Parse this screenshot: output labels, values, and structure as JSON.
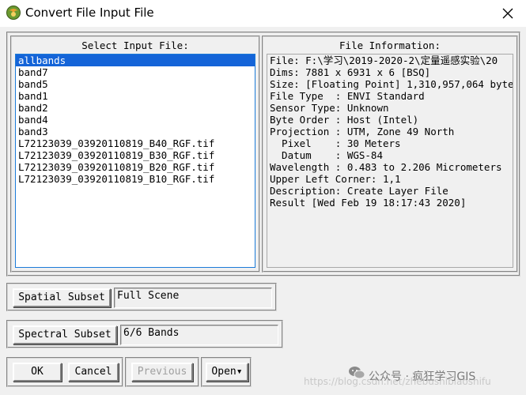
{
  "window": {
    "title": "Convert File Input File",
    "close_glyph": "✕"
  },
  "input_list": {
    "label": "Select Input File:",
    "items": [
      "allbands",
      "band7",
      "band5",
      "band1",
      "band2",
      "band4",
      "band3",
      "L72123039_03920110819_B40_RGF.tif",
      "L72123039_03920110819_B30_RGF.tif",
      "L72123039_03920110819_B20_RGF.tif",
      "L72123039_03920110819_B10_RGF.tif"
    ],
    "selected_index": 0
  },
  "file_info": {
    "label": "File Information:",
    "lines": [
      "File: F:\\学习\\2019-2020-2\\定量遥感实验\\20",
      "Dims: 7881 x 6931 x 6 [BSQ]",
      "Size: [Floating Point] 1,310,957,064 byte",
      "File Type  : ENVI Standard",
      "Sensor Type: Unknown",
      "Byte Order : Host (Intel)",
      "Projection : UTM, Zone 49 North",
      "  Pixel    : 30 Meters",
      "  Datum    : WGS-84",
      "Wavelength : 0.483 to 2.206 Micrometers",
      "Upper Left Corner: 1,1",
      "Description: Create Layer File",
      "Result [Wed Feb 19 18:17:43 2020]"
    ]
  },
  "spatial_subset": {
    "button_label": "Spatial Subset",
    "value": "Full Scene"
  },
  "spectral_subset": {
    "button_label": "Spectral Subset",
    "value": "6/6 Bands"
  },
  "buttons": {
    "ok": "OK",
    "cancel": "Cancel",
    "previous": "Previous",
    "open": "Open",
    "open_arrow": "▾"
  },
  "watermark": {
    "text": "公众号 · 疯狂学习GIS",
    "url": "https://blog.csdn.net/zhebushibiaoshifu"
  },
  "colors": {
    "selection": "#1464d8",
    "list_border": "#1c7bd8",
    "app_icon_green": "#5a8a2a",
    "app_icon_orange": "#e08a20"
  }
}
